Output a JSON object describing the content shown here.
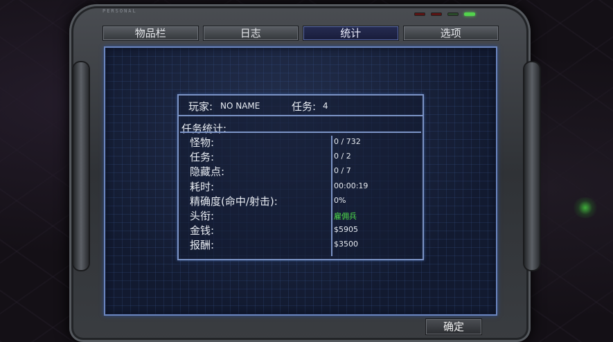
{
  "tabs": [
    {
      "label": "物品栏"
    },
    {
      "label": "日志"
    },
    {
      "label": "统计"
    },
    {
      "label": "选项"
    }
  ],
  "active_tab": "统计",
  "player": {
    "label": "玩家:",
    "name": "NO NAME"
  },
  "mission": {
    "label": "任务:",
    "value": "4"
  },
  "stats_heading": "任务统计:",
  "stats": [
    {
      "label": "怪物:",
      "value": "0 / 732"
    },
    {
      "label": "任务:",
      "value": "0 / 2"
    },
    {
      "label": "隐藏点:",
      "value": "0 / 7"
    },
    {
      "label": "耗时:",
      "value": "00:00:19"
    },
    {
      "label": "精确度(命中/射击):",
      "value": "0%"
    },
    {
      "label": "头衔:",
      "value": "雇佣兵"
    },
    {
      "label": "金钱:",
      "value": "$5905"
    },
    {
      "label": "报酬:",
      "value": "$3500"
    }
  ],
  "confirm_label": "确定",
  "colors": {
    "title_value": "#4fe04a",
    "grid_border": "#7c94c6",
    "active_tab": "#1e2348"
  }
}
